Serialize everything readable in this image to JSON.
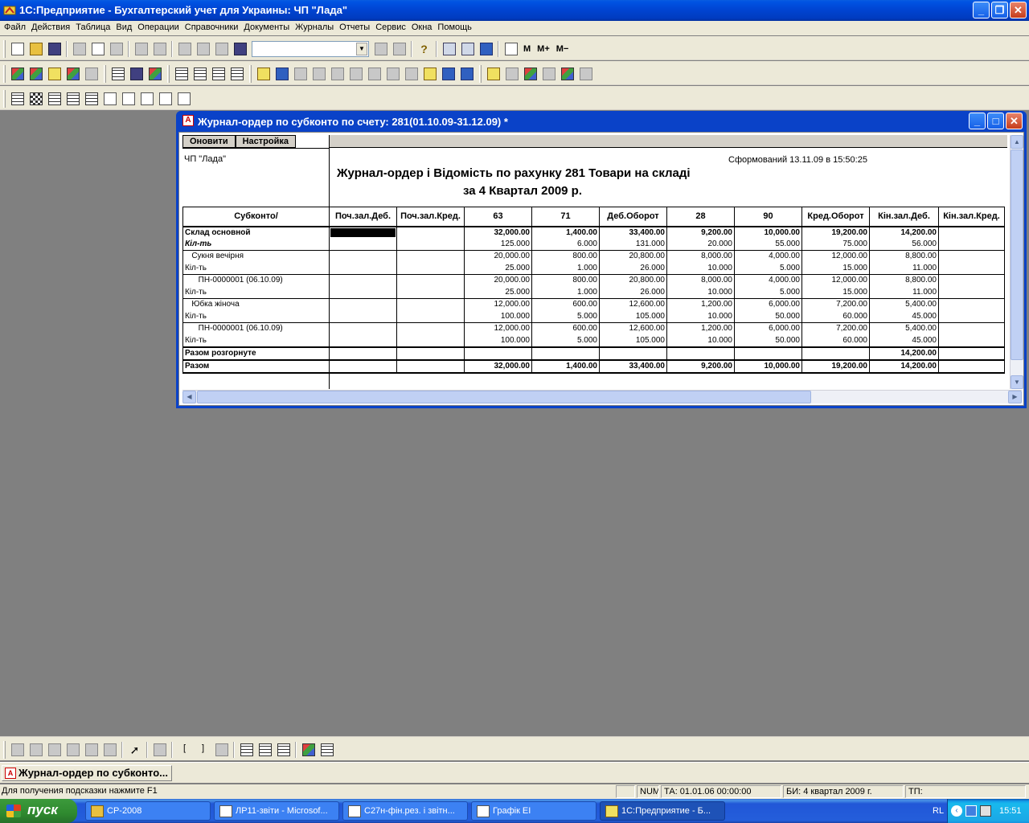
{
  "app": {
    "title": "1С:Предприятие - Бухгалтерский учет для Украины: ЧП \"Лада\""
  },
  "menu": [
    "Файл",
    "Действия",
    "Таблица",
    "Вид",
    "Операции",
    "Справочники",
    "Документы",
    "Журналы",
    "Отчеты",
    "Сервис",
    "Окна",
    "Помощь"
  ],
  "toolbar": {
    "memory_buttons": [
      "M",
      "M+",
      "M−"
    ],
    "search_value": ""
  },
  "child_window": {
    "title": "Журнал-ордер по субконто по счету: 281(01.10.09-31.12.09)  *",
    "buttons": {
      "refresh": "Оновити",
      "settings": "Настройка"
    }
  },
  "report": {
    "org": "ЧП \"Лада\"",
    "generated": "Сформований 13.11.09 в 15:50:25",
    "title_line1": "Журнал-ордер і Відомість по рахунку 281 Товари на складі",
    "title_line2": "за 4 Квартал 2009 р.",
    "columns": [
      "Субконто/",
      "Поч.зал.Деб.",
      "Поч.зал.Кред.",
      "63",
      "71",
      "Деб.Оборот",
      "28",
      "90",
      "Кред.Оборот",
      "Кін.зал.Деб.",
      "Кін.зал.Кред."
    ],
    "rows": [
      {
        "style": "b",
        "cells": [
          "Склад основной",
          "",
          "",
          "32,000.00",
          "1,400.00",
          "33,400.00",
          "9,200.00",
          "10,000.00",
          "19,200.00",
          "14,200.00",
          ""
        ]
      },
      {
        "style": "bi",
        "cells": [
          "Кіл-ть",
          "",
          "",
          "125.000",
          "6.000",
          "131.000",
          "20.000",
          "55.000",
          "75.000",
          "56.000",
          ""
        ]
      },
      {
        "style": "grp",
        "cells": [
          "   Сукня вечірня",
          "",
          "",
          "20,000.00",
          "800.00",
          "20,800.00",
          "8,000.00",
          "4,000.00",
          "12,000.00",
          "8,800.00",
          ""
        ]
      },
      {
        "style": "",
        "cells": [
          "Кіл-ть",
          "",
          "",
          "25.000",
          "1.000",
          "26.000",
          "10.000",
          "5.000",
          "15.000",
          "11.000",
          ""
        ]
      },
      {
        "style": "grp",
        "cells": [
          "      ПН-0000001 (06.10.09)",
          "",
          "",
          "20,000.00",
          "800.00",
          "20,800.00",
          "8,000.00",
          "4,000.00",
          "12,000.00",
          "8,800.00",
          ""
        ]
      },
      {
        "style": "",
        "cells": [
          "Кіл-ть",
          "",
          "",
          "25.000",
          "1.000",
          "26.000",
          "10.000",
          "5.000",
          "15.000",
          "11.000",
          ""
        ]
      },
      {
        "style": "grp",
        "cells": [
          "   Юбка жіноча",
          "",
          "",
          "12,000.00",
          "600.00",
          "12,600.00",
          "1,200.00",
          "6,000.00",
          "7,200.00",
          "5,400.00",
          ""
        ]
      },
      {
        "style": "",
        "cells": [
          "Кіл-ть",
          "",
          "",
          "100.000",
          "5.000",
          "105.000",
          "10.000",
          "50.000",
          "60.000",
          "45.000",
          ""
        ]
      },
      {
        "style": "grp",
        "cells": [
          "      ПН-0000001 (06.10.09)",
          "",
          "",
          "12,000.00",
          "600.00",
          "12,600.00",
          "1,200.00",
          "6,000.00",
          "7,200.00",
          "5,400.00",
          ""
        ]
      },
      {
        "style": "lastg",
        "cells": [
          "Кіл-ть",
          "",
          "",
          "100.000",
          "5.000",
          "105.000",
          "10.000",
          "50.000",
          "60.000",
          "45.000",
          ""
        ]
      },
      {
        "style": "b tot",
        "cells": [
          "Разом розгорнуте",
          "",
          "",
          "",
          "",
          "",
          "",
          "",
          "",
          "14,200.00",
          ""
        ]
      },
      {
        "style": "b tot",
        "cells": [
          "Разом",
          "",
          "",
          "32,000.00",
          "1,400.00",
          "33,400.00",
          "9,200.00",
          "10,000.00",
          "19,200.00",
          "14,200.00",
          ""
        ]
      }
    ]
  },
  "window_list": {
    "item": "Журнал-ордер по субконто..."
  },
  "status": {
    "hint": "Для получения подсказки нажмите F1",
    "num": "NUM",
    "ta": "ТА: 01.01.06  00:00:00",
    "bi": "БИ: 4 квартал 2009 г.",
    "tp": "ТП:"
  },
  "taskbar": {
    "start": "пуск",
    "tasks": [
      "СР-2008",
      "ЛР11-звіти - Microsof...",
      "С27н-фін.рез. і звітн...",
      "Графік ЕІ",
      "1С:Предприятие - Б..."
    ],
    "lang": "RL",
    "clock": "15:51"
  },
  "colors": {
    "xp_blue": "#0054e3",
    "face": "#ece9d8",
    "workspace": "#808080"
  }
}
